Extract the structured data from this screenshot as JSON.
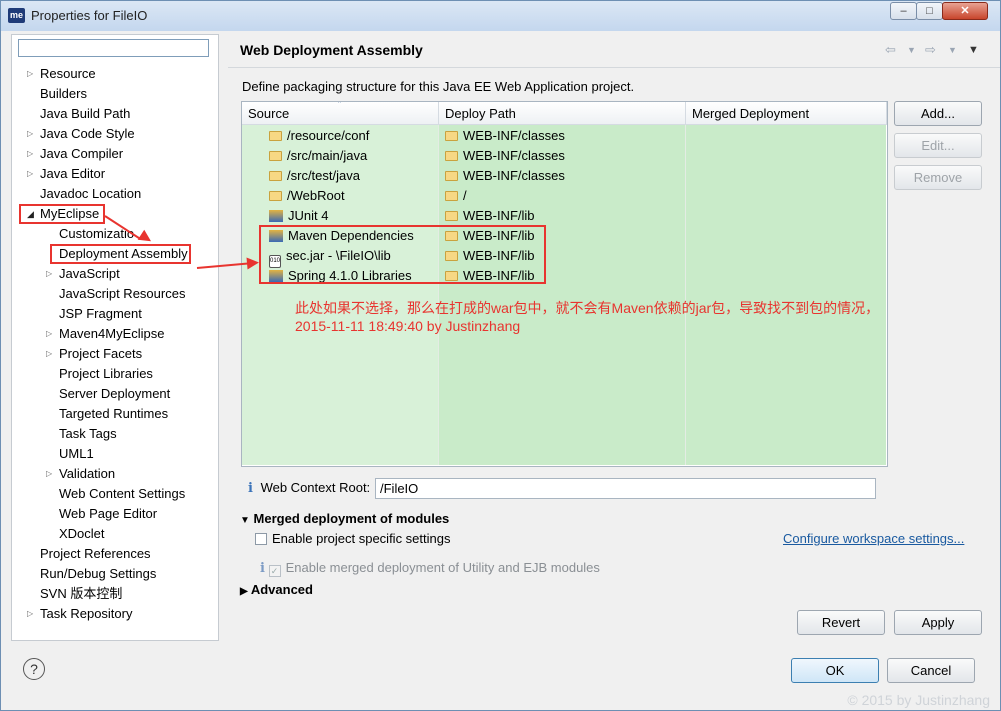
{
  "window": {
    "app_icon": "me",
    "title": "Properties for FileIO",
    "controls": [
      "minimize-icon",
      "maximize-icon",
      "close-icon"
    ]
  },
  "left_tree": {
    "filter_value": "",
    "items": [
      {
        "label": "Resource",
        "expandable": true
      },
      {
        "label": "Builders",
        "expandable": false
      },
      {
        "label": "Java Build Path",
        "expandable": false
      },
      {
        "label": "Java Code Style",
        "expandable": true
      },
      {
        "label": "Java Compiler",
        "expandable": true
      },
      {
        "label": "Java Editor",
        "expandable": true
      },
      {
        "label": "Javadoc Location",
        "expandable": false
      },
      {
        "label": "MyEclipse",
        "expandable": true,
        "expanded": true
      },
      {
        "label": "Customizatio",
        "expandable": false
      },
      {
        "label": "Deployment Assembly",
        "expandable": false,
        "selected": true
      },
      {
        "label": "JavaScript",
        "expandable": true
      },
      {
        "label": "JavaScript Resources",
        "expandable": false
      },
      {
        "label": "JSP Fragment",
        "expandable": false
      },
      {
        "label": "Maven4MyEclipse",
        "expandable": true
      },
      {
        "label": "Project Facets",
        "expandable": true
      },
      {
        "label": "Project Libraries",
        "expandable": false
      },
      {
        "label": "Server Deployment",
        "expandable": false
      },
      {
        "label": "Targeted Runtimes",
        "expandable": false
      },
      {
        "label": "Task Tags",
        "expandable": false
      },
      {
        "label": "UML1",
        "expandable": false
      },
      {
        "label": "Validation",
        "expandable": true
      },
      {
        "label": "Web Content Settings",
        "expandable": false
      },
      {
        "label": "Web Page Editor",
        "expandable": false
      },
      {
        "label": "XDoclet",
        "expandable": false
      },
      {
        "label": "Project References",
        "expandable": false
      },
      {
        "label": "Run/Debug Settings",
        "expandable": false
      },
      {
        "label": "SVN 版本控制",
        "expandable": false
      },
      {
        "label": "Task Repository",
        "expandable": true
      }
    ]
  },
  "page": {
    "title": "Web Deployment Assembly",
    "description": "Define packaging structure for this Java EE Web Application project.",
    "columns": [
      "Source",
      "Deploy Path",
      "Merged Deployment"
    ],
    "rows": [
      {
        "icon": "folder-icon",
        "source": "/resource/conf",
        "deploy": "WEB-INF/classes",
        "merged": ""
      },
      {
        "icon": "folder-icon",
        "source": "/src/main/java",
        "deploy": "WEB-INF/classes",
        "merged": ""
      },
      {
        "icon": "folder-icon",
        "source": "/src/test/java",
        "deploy": "WEB-INF/classes",
        "merged": ""
      },
      {
        "icon": "folder-icon",
        "source": "/WebRoot",
        "deploy": "/",
        "merged": ""
      },
      {
        "icon": "library-icon",
        "source": "JUnit 4",
        "deploy": "WEB-INF/lib",
        "merged": ""
      },
      {
        "icon": "library-icon",
        "source": "Maven Dependencies",
        "deploy": "WEB-INF/lib",
        "merged": ""
      },
      {
        "icon": "jar-icon",
        "source": "sec.jar - \\FileIO\\lib",
        "deploy": "WEB-INF/lib",
        "merged": ""
      },
      {
        "icon": "library-icon",
        "source": "Spring 4.1.0 Libraries",
        "deploy": "WEB-INF/lib",
        "merged": ""
      }
    ],
    "side_buttons": {
      "add": "Add...",
      "edit": "Edit...",
      "remove": "Remove"
    },
    "context_root_label": "Web Context Root:",
    "context_root_value": "/FileIO",
    "merged_section": "Merged deployment of modules",
    "enable_project_specific": "Enable project specific settings",
    "configure_link": "Configure workspace settings...",
    "enable_merged": "Enable merged deployment of Utility and EJB modules",
    "advanced_section": "Advanced",
    "revert": "Revert",
    "apply": "Apply"
  },
  "annotation": {
    "line1": "此处如果不选择，那么在打成的war包中，就不会有Maven依赖的jar包，导致找不到包的情况，",
    "line2": "2015-11-11 18:49:40  by Justinzhang",
    "color": "#e8342f"
  },
  "footer": {
    "ok": "OK",
    "cancel": "Cancel",
    "watermark": "© 2015  by Justinzhang"
  }
}
